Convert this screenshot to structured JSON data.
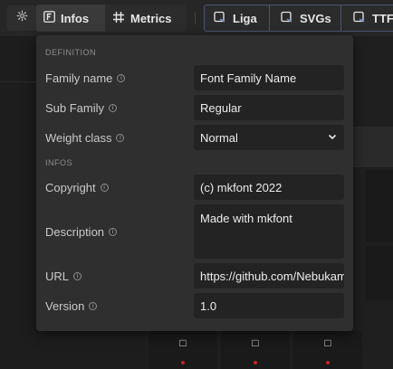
{
  "toolbar": {
    "settings_icon": "gear-icon",
    "tabs": [
      {
        "label": "Infos",
        "icon": "font-file-icon",
        "active": true
      },
      {
        "label": "Metrics",
        "icon": "hash-grid-icon",
        "active": false
      }
    ],
    "exports": [
      {
        "label": "Liga",
        "icon": "export-icon"
      },
      {
        "label": "SVGs",
        "icon": "export-icon"
      },
      {
        "label": "TTF",
        "icon": "export-icon"
      }
    ]
  },
  "popover": {
    "sections": {
      "definition": "DEFINITION",
      "infos": "INFOS"
    },
    "fields": {
      "family_name": {
        "label": "Family name",
        "value": "Font Family Name"
      },
      "sub_family": {
        "label": "Sub Family",
        "value": "Regular"
      },
      "weight_class": {
        "label": "Weight class",
        "value": "Normal"
      },
      "copyright": {
        "label": "Copyright",
        "value": "(c) mkfont 2022"
      },
      "description": {
        "label": "Description",
        "value": "Made with mkfont"
      },
      "url": {
        "label": "URL",
        "value": "https://github.com/Nebukam/mkfont"
      },
      "version": {
        "label": "Version",
        "value": "1.0"
      }
    }
  },
  "glyph_grid": {
    "cell_glyph": "□"
  },
  "colors": {
    "accent_border": "#4a5570",
    "popover_bg": "#2f2f2f",
    "field_bg": "#232323",
    "glyph_dot": "#c32525"
  }
}
